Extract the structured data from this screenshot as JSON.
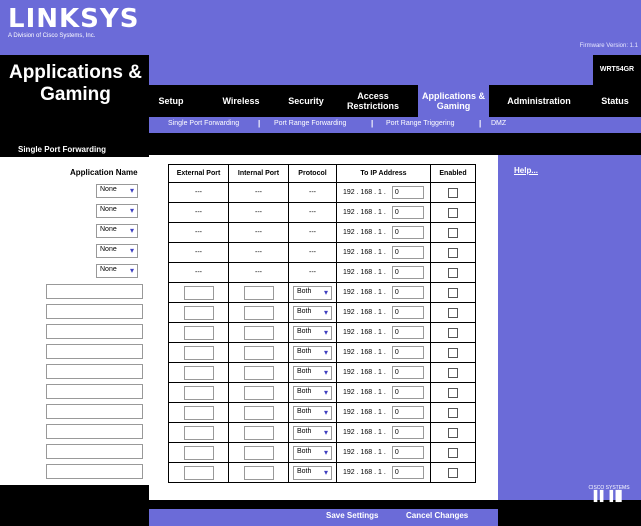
{
  "header": {
    "brand": "LINKSYS",
    "brand_sub": "A Division of Cisco Systems, Inc.",
    "firmware": "Firmware Version: 1.1",
    "model": "WRT54GR",
    "section": "Applications & Gaming"
  },
  "tabs": [
    {
      "label": "Setup"
    },
    {
      "label": "Wireless"
    },
    {
      "label": "Security"
    },
    {
      "label": "Access Restrictions"
    },
    {
      "label": "Applications & Gaming",
      "active": true
    },
    {
      "label": "Administration"
    },
    {
      "label": "Status"
    }
  ],
  "subnav": [
    "Single Port Forwarding",
    "Port Range Forwarding",
    "Port Range Triggering",
    "DMZ"
  ],
  "left": {
    "heading": "Single Port Forwarding",
    "app_name_label": "Application Name",
    "select_value": "None"
  },
  "table": {
    "headers": [
      "External Port",
      "Internal Port",
      "Protocol",
      "To IP Address",
      "Enabled"
    ],
    "fixed_rows": 5,
    "custom_rows": 10,
    "dash": "---",
    "protocol_default": "Both",
    "ip_prefix": "192 . 168 . 1 .",
    "ip_last": "0"
  },
  "help": "Help...",
  "buttons": {
    "save": "Save Settings",
    "cancel": "Cancel Changes"
  },
  "cisco": "CISCO SYSTEMS",
  "colors": {
    "accent": "#6b6bd8",
    "black": "#000000"
  }
}
